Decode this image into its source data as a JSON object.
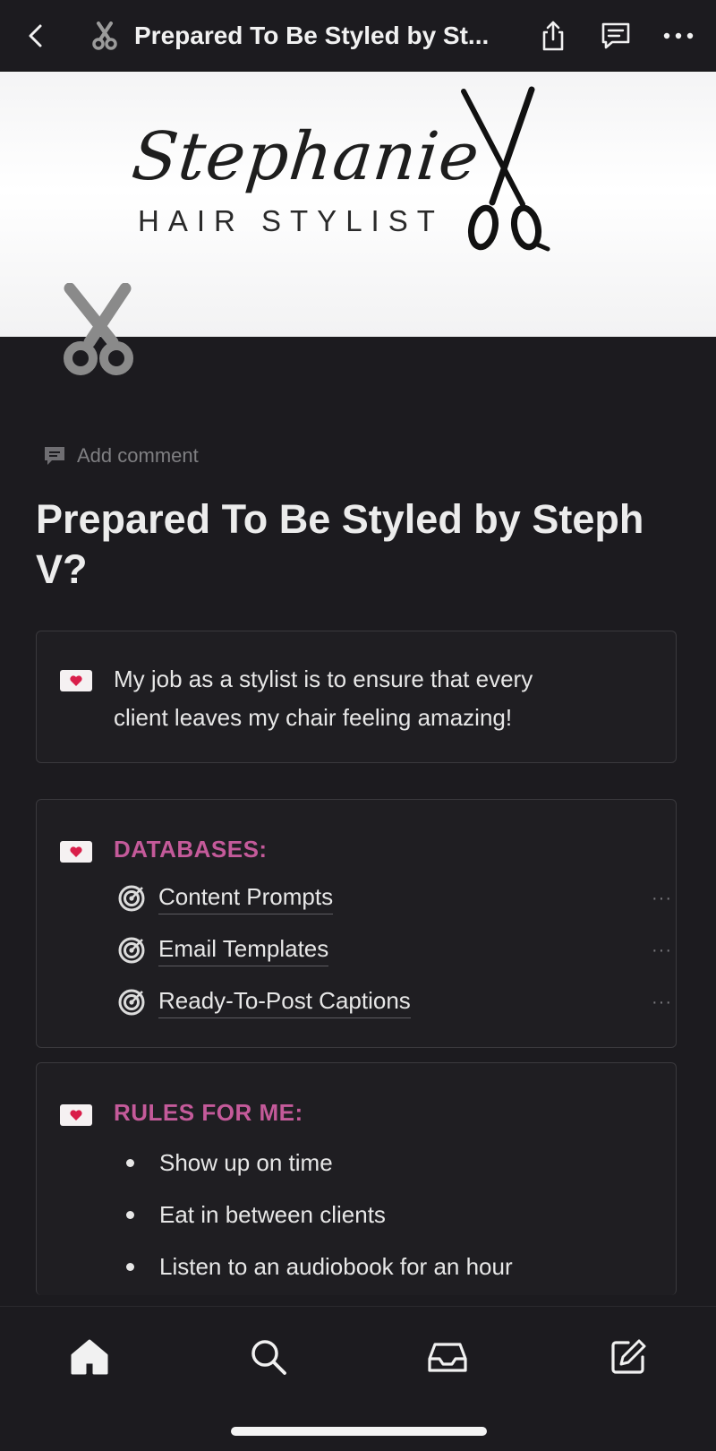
{
  "topbar": {
    "title": "Prepared To Be Styled by St...",
    "icons": [
      "chevron-left-icon",
      "scissors-icon",
      "share-icon",
      "comment-icon",
      "more-icon"
    ]
  },
  "cover": {
    "script_name": "Stephanie",
    "subtitle": "HAIR STYLIST"
  },
  "page": {
    "add_comment": "Add comment",
    "title": "Prepared To Be Styled by Steph V?"
  },
  "callout_intro": {
    "line1": "My job as a stylist is to ensure that every",
    "line2": "client leaves my chair feeling amazing!"
  },
  "databases": {
    "heading": "DATABASES:",
    "items": [
      {
        "label": "Content Prompts",
        "more": "···"
      },
      {
        "label": "Email Templates",
        "more": "···"
      },
      {
        "label": "Ready-To-Post Captions",
        "more": "···"
      }
    ]
  },
  "rules": {
    "heading": "RULES FOR ME:",
    "items": [
      "Show up on time",
      "Eat in between clients",
      "Listen to an audiobook for an hour"
    ]
  },
  "bottom_nav": {
    "items": [
      "home-icon",
      "search-icon",
      "inbox-icon",
      "new-page-icon"
    ]
  },
  "colors": {
    "background": "#1c1b1f",
    "accent_pink": "#c45a9a",
    "text": "#e7e7e7"
  }
}
